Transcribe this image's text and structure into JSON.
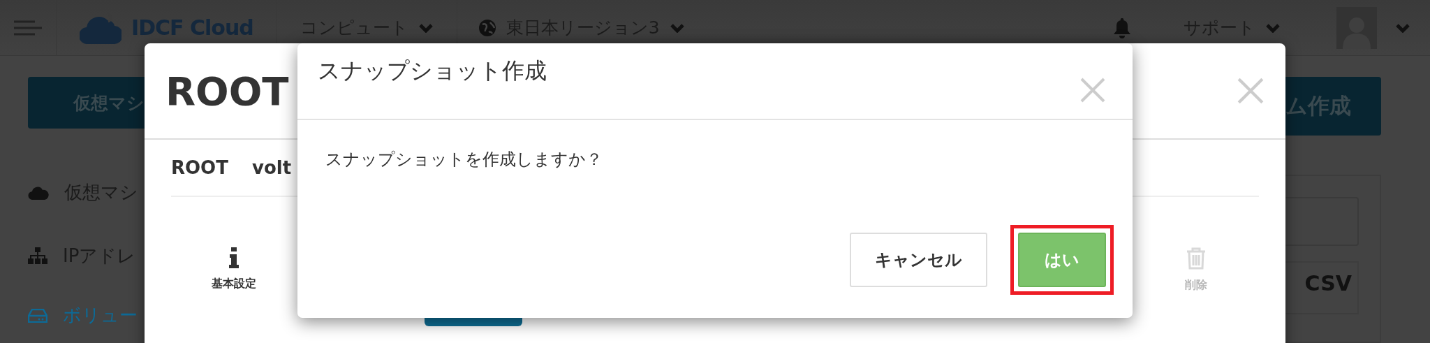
{
  "header": {
    "brand": "IDCF Cloud",
    "nav": [
      {
        "label": "コンピュート"
      },
      {
        "label": "東日本リージョン3"
      }
    ],
    "support": "サポート"
  },
  "sidebar": {
    "primary_button": "仮想マシ",
    "items": [
      {
        "label": "仮想マシ",
        "selected": false
      },
      {
        "label": "IPアドレ",
        "selected": false
      },
      {
        "label": "ボリュー",
        "selected": true
      }
    ]
  },
  "right_panel": {
    "create_button": "ム作成",
    "csv_button": "CSV"
  },
  "detail_modal": {
    "title": "ROOT",
    "subtitle": [
      "ROOT",
      "volt"
    ],
    "actions": [
      {
        "label": "基本設定",
        "disabled": false
      },
      {
        "label": "削除",
        "disabled": true
      }
    ]
  },
  "dialog": {
    "title": "スナップショット作成",
    "message": "スナップショットを作成しますか？",
    "buttons": [
      {
        "label": "キャンセル",
        "kind": "default",
        "highlighted": false
      },
      {
        "label": "はい",
        "kind": "primary",
        "highlighted": true
      }
    ]
  }
}
